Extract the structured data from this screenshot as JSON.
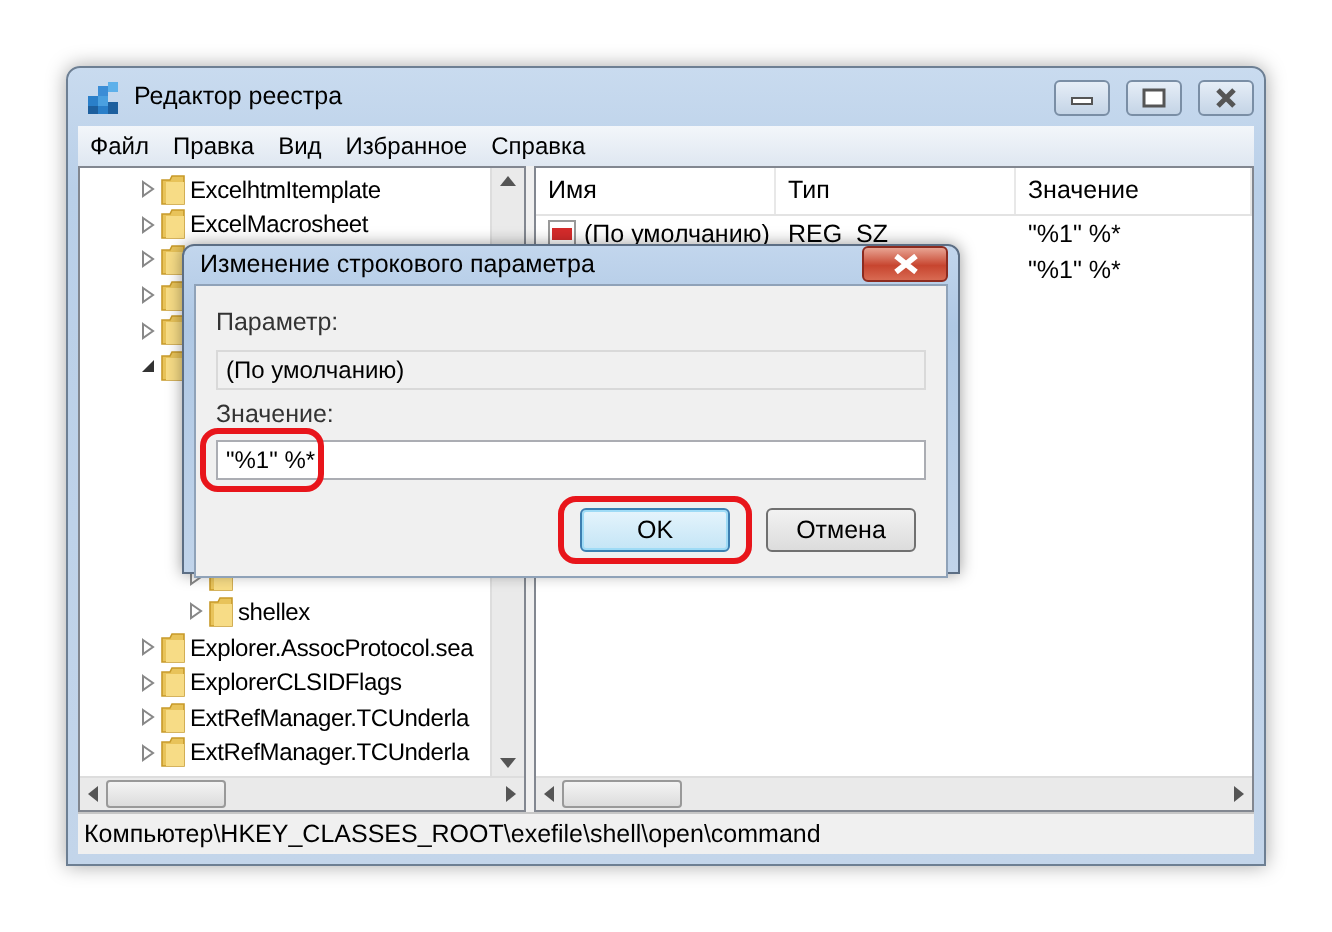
{
  "window": {
    "title": "Редактор реестра"
  },
  "menu": [
    "Файл",
    "Правка",
    "Вид",
    "Избранное",
    "Справка"
  ],
  "tree": {
    "items": [
      {
        "label": "ExcelhtmItemplate",
        "expanded": false
      },
      {
        "label": "ExcelMacrosheet",
        "expanded": false
      },
      {
        "expanded": false
      },
      {
        "expanded": false
      },
      {
        "expanded": false
      },
      {
        "expanded": true,
        "children": [
          {
            "expanded": false
          },
          {
            "label": "shellex",
            "expanded": false
          }
        ]
      },
      {
        "label": "Explorer.AssocProtocol.sea",
        "expanded": false
      },
      {
        "label": "ExplorerCLSIDFlags",
        "expanded": false
      },
      {
        "label": "ExtRefManager.TCUnderla",
        "expanded": false
      },
      {
        "label": "ExtRefManager.TCUnderla",
        "expanded": false
      }
    ]
  },
  "values": {
    "columns": [
      "Имя",
      "Тип",
      "Значение"
    ],
    "rows": [
      {
        "name": "(По умолчанию)",
        "type": "REG_SZ",
        "data": "\"%1\" %*"
      },
      {
        "data": "\"%1\" %*"
      }
    ]
  },
  "status_bar": "Компьютер\\HKEY_CLASSES_ROOT\\exefile\\shell\\open\\command",
  "dialog": {
    "title": "Изменение строкового параметра",
    "fields": [
      {
        "label": "Параметр:",
        "value": "(По умолчанию)",
        "readonly": true,
        "highlighted": false
      },
      {
        "label": "Значение:",
        "value": "\"%1\" %*",
        "readonly": false,
        "highlighted": true
      }
    ],
    "buttons": [
      {
        "label": "OK",
        "default": true,
        "highlighted": true
      },
      {
        "label": "Отмена",
        "default": false,
        "highlighted": false
      }
    ]
  }
}
